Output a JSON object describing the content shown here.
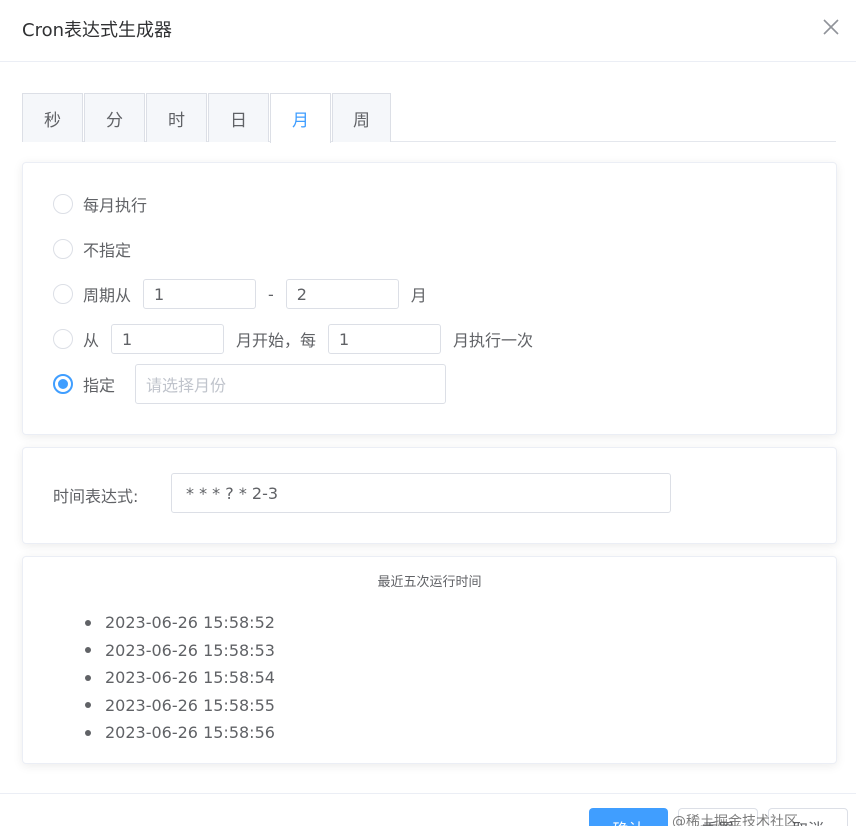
{
  "dialog": {
    "title": "Cron表达式生成器",
    "close_icon": "close-icon"
  },
  "tabs": [
    {
      "label": "秒",
      "active": false
    },
    {
      "label": "分",
      "active": false
    },
    {
      "label": "时",
      "active": false
    },
    {
      "label": "日",
      "active": false
    },
    {
      "label": "月",
      "active": true
    },
    {
      "label": "周",
      "active": false
    }
  ],
  "month": {
    "every_label": "每月执行",
    "unspecified_label": "不指定",
    "period": {
      "label": "周期从",
      "from": "1",
      "dash": "-",
      "to": "2",
      "unit": "月"
    },
    "step": {
      "label": "从",
      "start": "1",
      "mid": "月开始，每",
      "interval": "1",
      "suffix": "月执行一次"
    },
    "specify": {
      "label": "指定",
      "placeholder": "请选择月份"
    },
    "selected": "specify"
  },
  "expression": {
    "label": "时间表达式:",
    "value": "* * * ? * 2-3"
  },
  "runs": {
    "title": "最近五次运行时间",
    "items": [
      "2023-06-26 15:58:52",
      "2023-06-26 15:58:53",
      "2023-06-26 15:58:54",
      "2023-06-26 15:58:55",
      "2023-06-26 15:58:56"
    ]
  },
  "footer": {
    "ok_label": "确认",
    "reset_label": "重置",
    "cancel_label": "取消",
    "watermark": "@稀土掘金技术社区"
  },
  "colors": {
    "accent": "#409eff",
    "border": "#dcdfe6",
    "text": "#606266"
  }
}
